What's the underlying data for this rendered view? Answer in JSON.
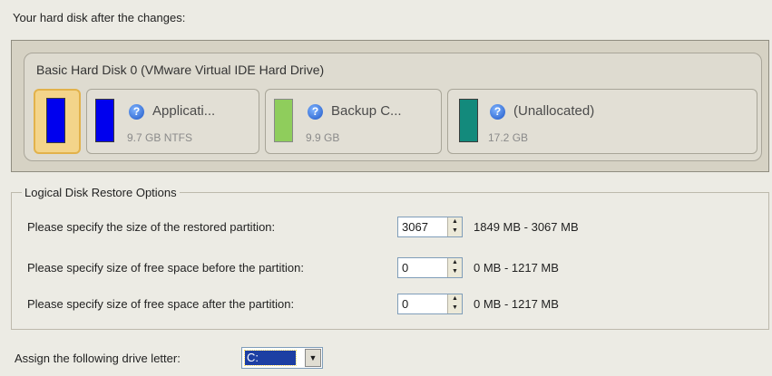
{
  "heading": "Your hard disk after the changes:",
  "disk": {
    "title": "Basic Hard Disk 0 (VMware Virtual IDE Hard Drive)",
    "partitions": [
      {
        "name": "",
        "size": "",
        "color": "#0000ee",
        "selected": true
      },
      {
        "name": "Applicati...",
        "size": "9.7 GB NTFS",
        "color": "#0000ee",
        "icon": "help-icon"
      },
      {
        "name": "Backup C...",
        "size": "9.9 GB",
        "color": "#8fcd5c",
        "icon": "help-icon"
      },
      {
        "name": "(Unallocated)",
        "size": "17.2 GB",
        "color": "#138a7c",
        "icon": "help-icon"
      }
    ]
  },
  "restore_options": {
    "title": "Logical Disk Restore Options",
    "rows": [
      {
        "label": "Please specify the size of the restored partition:",
        "value": "3067",
        "range": "1849 MB - 3067 MB"
      },
      {
        "label": "Please specify size of free space before the partition:",
        "value": "0",
        "range": "0 MB - 1217 MB"
      },
      {
        "label": "Please specify size of free space after the partition:",
        "value": "0",
        "range": "0 MB - 1217 MB"
      }
    ]
  },
  "drive_letter": {
    "label": "Assign the following drive letter:",
    "value": "C:"
  }
}
